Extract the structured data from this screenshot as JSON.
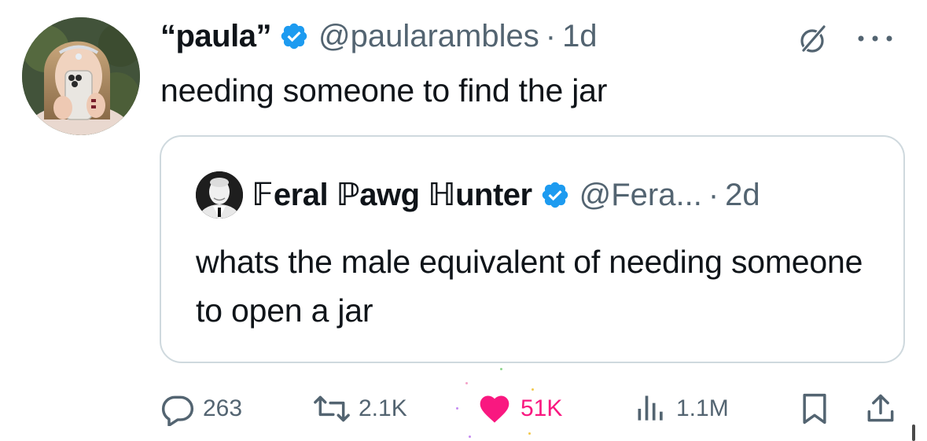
{
  "tweet": {
    "display_name": "“paula”",
    "handle": "@paularambles",
    "separator": "·",
    "time": "1d",
    "text": "needing someone to find the jar"
  },
  "quote": {
    "display_name": "𝔽eral ℙawg ℍunter",
    "handle": "@Fera...",
    "separator": "·",
    "time": "2d",
    "text": "whats the male equivalent of needing someone to open a jar"
  },
  "actions": {
    "replies": "263",
    "reposts": "2.1K",
    "likes": "51K",
    "views": "1.1M"
  },
  "colors": {
    "verified": "#1d9bf0",
    "like": "#f91880",
    "secondary_text": "#536471",
    "border": "#cfd9de"
  },
  "icons": {
    "grok": "grok-icon",
    "more": "more-icon",
    "reply": "reply-icon",
    "repost": "repost-icon",
    "like": "heart-icon",
    "views": "views-icon",
    "bookmark": "bookmark-icon",
    "share": "share-icon"
  }
}
